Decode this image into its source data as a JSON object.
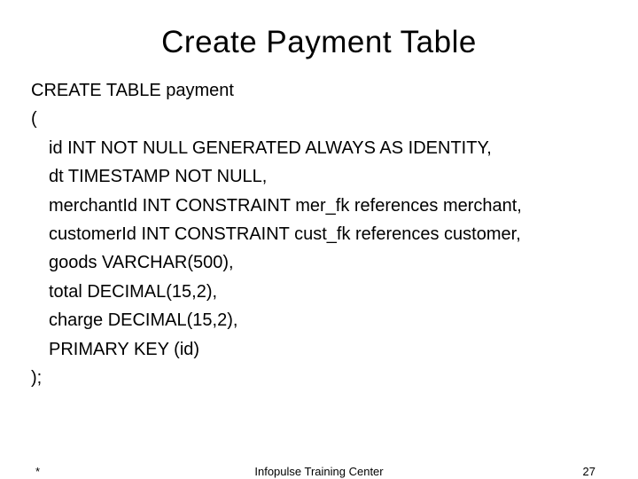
{
  "title": "Create Payment Table",
  "code": {
    "l1": "CREATE TABLE payment",
    "l2": "(",
    "l3": "id INT NOT NULL GENERATED ALWAYS AS IDENTITY,",
    "l4": "dt TIMESTAMP NOT NULL,",
    "l5": "merchantId INT CONSTRAINT mer_fk references merchant,",
    "l6": "customerId INT CONSTRAINT cust_fk references customer,",
    "l7": "goods VARCHAR(500),",
    "l8": "total DECIMAL(15,2),",
    "l9": "charge DECIMAL(15,2),",
    "l10": "PRIMARY KEY (id)",
    "l11": ");"
  },
  "footer": {
    "left": "*",
    "center": "Infopulse Training Center",
    "right": "27"
  }
}
